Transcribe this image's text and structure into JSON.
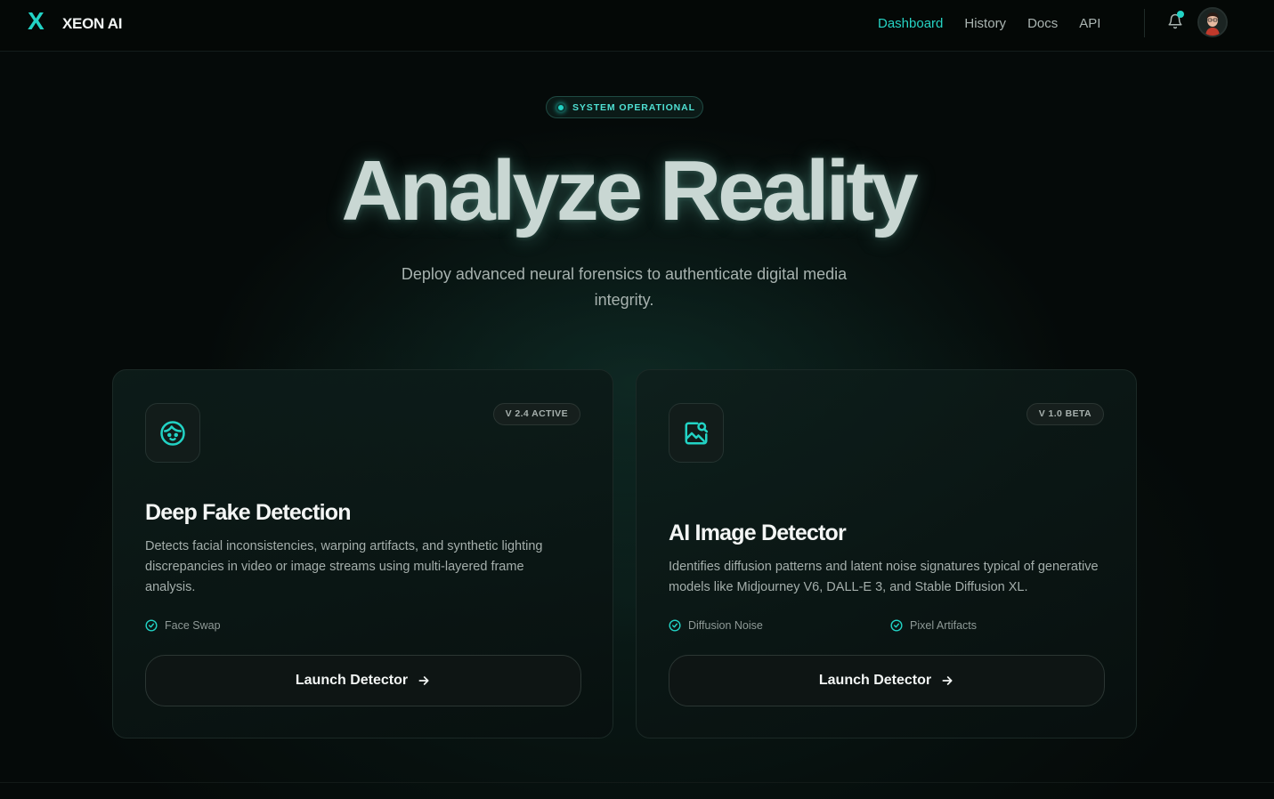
{
  "brand": {
    "mark": "X",
    "name": "XEON AI",
    "accent": "#22d3c5"
  },
  "nav": {
    "links": [
      {
        "label": "Dashboard",
        "active": true
      },
      {
        "label": "History",
        "active": false
      },
      {
        "label": "Docs",
        "active": false
      },
      {
        "label": "API",
        "active": false
      }
    ],
    "notification_icon": "bell-icon",
    "has_unread": true
  },
  "hero": {
    "status": "SYSTEM OPERATIONAL",
    "title": "Analyze Reality",
    "subtitle": "Deploy advanced neural forensics to authenticate digital media integrity."
  },
  "cards": [
    {
      "icon": "face-icon",
      "badge": "V 2.4 ACTIVE",
      "title": "Deep Fake Detection",
      "description": "Detects facial inconsistencies, warping artifacts, and synthetic lighting discrepancies in video or image streams using multi-layered frame analysis.",
      "features": [
        "Face Swap"
      ],
      "button": "Launch Detector"
    },
    {
      "icon": "image-search-icon",
      "badge": "V 1.0 BETA",
      "title": "AI Image Detector",
      "description": "Identifies diffusion patterns and latent noise signatures typical of generative models like Midjourney V6, DALL-E 3, and Stable Diffusion XL.",
      "features": [
        "Diffusion Noise",
        "Pixel Artifacts"
      ],
      "button": "Launch Detector"
    }
  ]
}
